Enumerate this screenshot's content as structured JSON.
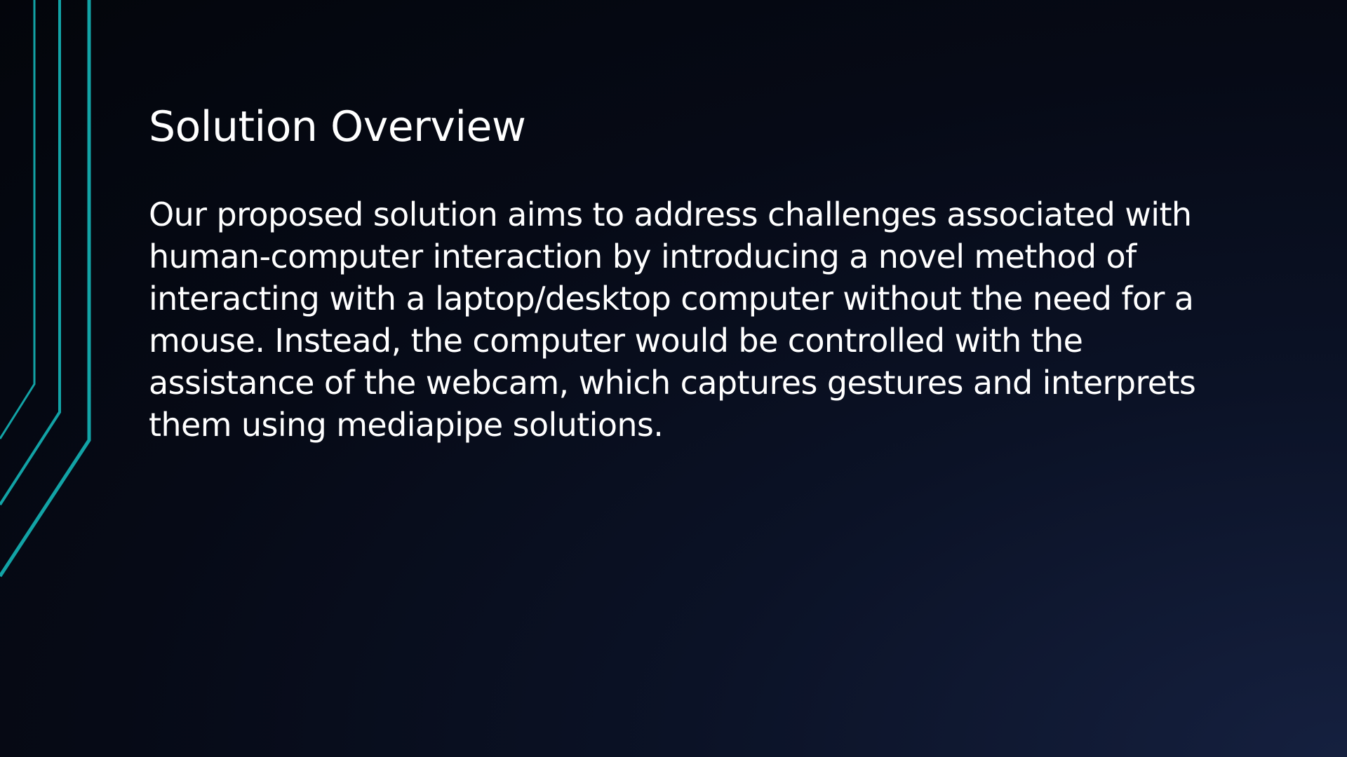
{
  "slide": {
    "title": "Solution Overview",
    "body_lines": [
      "Our proposed solution aims to address challenges associated with",
      "human-computer interaction by introducing a novel method of",
      "interacting with a laptop/desktop computer without the need for a",
      "mouse. Instead, the computer would be controlled with the",
      "assistance of the webcam, which captures gestures and interprets",
      "them using mediapipe solutions."
    ]
  },
  "theme": {
    "accent_color": "#12a3a6",
    "text_color": "#ffffff",
    "background_color": "#060a16"
  }
}
